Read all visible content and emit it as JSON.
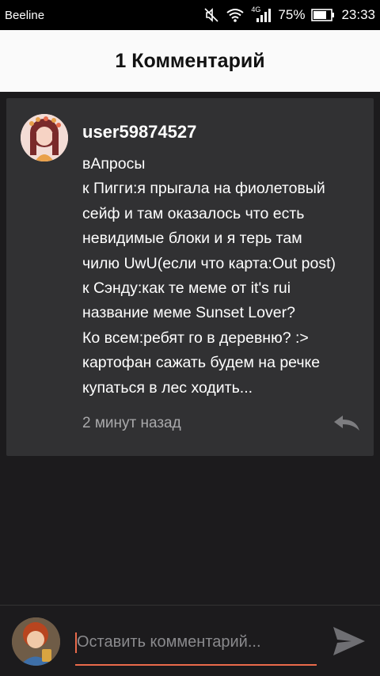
{
  "status_bar": {
    "carrier": "Beeline",
    "network_tag": "4G",
    "battery_percent": "75%",
    "time": "23:33"
  },
  "header": {
    "title": "1 Комментарий"
  },
  "comment": {
    "username": "user59874527",
    "text_lines": [
      "вАпросы",
      "к Пигги:я прыгала на фиолетовый",
      "сейф и там оказалось что есть",
      "невидимые блоки и я терь там",
      "чилю UwU(если что карта:Out post)",
      "к Сэнду:как те меме от it's rui",
      "название меме Sunset Lover?",
      "Ко всем:ребят го в деревню? :>",
      "картофан сажать будем на речке",
      "купаться в лес ходить..."
    ],
    "timestamp": "2 минут назад",
    "reply_icon": "reply-icon"
  },
  "composer": {
    "placeholder": "Оставить комментарий...",
    "send_icon": "send-icon"
  },
  "colors": {
    "accent": "#ea6a4b",
    "card_bg": "#313133",
    "page_bg": "#1c1b1d",
    "header_bg": "#fafafa"
  }
}
